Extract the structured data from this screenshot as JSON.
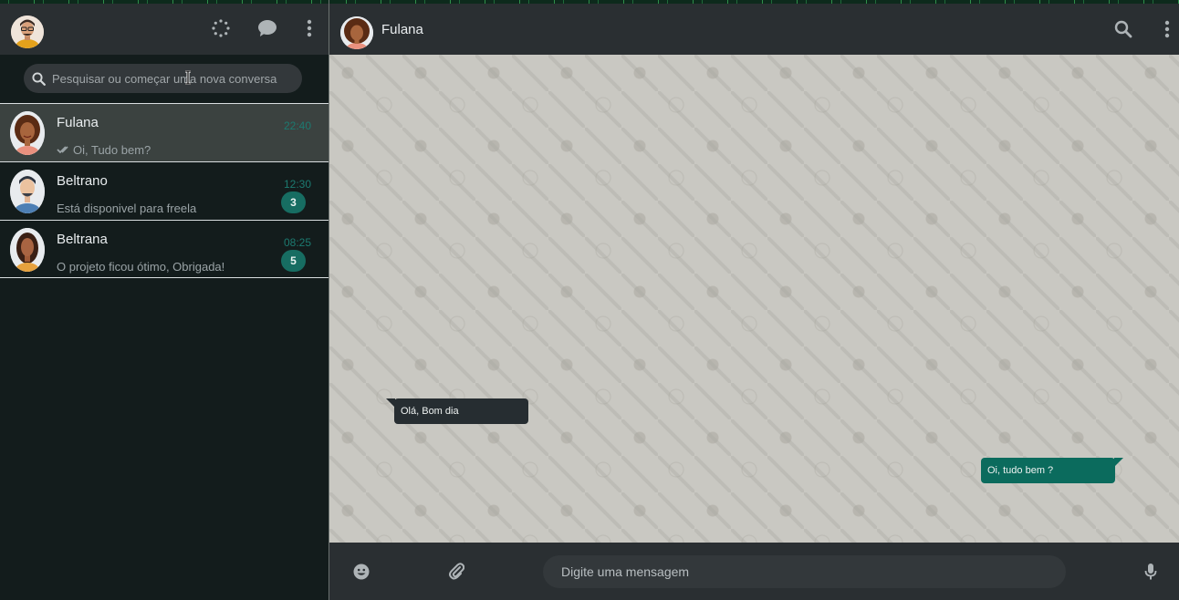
{
  "sidebar": {
    "search": {
      "placeholder": "Pesquisar ou começar uma nova conversa"
    },
    "chats": [
      {
        "name": "Fulana",
        "time": "22:40",
        "preview": "Oi, Tudo bem?",
        "read_receipt": true,
        "unread": null,
        "active": true
      },
      {
        "name": "Beltrano",
        "time": "12:30",
        "preview": "Está disponivel para freela",
        "read_receipt": false,
        "unread": "3",
        "active": false
      },
      {
        "name": "Beltrana",
        "time": "08:25",
        "preview": "O projeto ficou ótimo, Obrigada!",
        "read_receipt": false,
        "unread": "5",
        "active": false
      }
    ]
  },
  "conversation": {
    "contact_name": "Fulana",
    "messages": [
      {
        "direction": "incoming",
        "text": "Olá, Bom dia"
      },
      {
        "direction": "outgoing",
        "text": "Oi, tudo bem ?"
      }
    ],
    "composer": {
      "placeholder": "Digite uma mensagem"
    }
  },
  "icons": {
    "status": "status-icon",
    "new_chat": "chat-icon",
    "menu": "menu-dots-icon",
    "search": "search-icon",
    "emoji": "emoji-icon",
    "attach": "paperclip-icon",
    "mic": "mic-icon",
    "read": "double-check-icon"
  },
  "colors": {
    "accent": "#0b6b5d",
    "header": "#2a2f32",
    "sidebar_bg": "#131c1c",
    "chat_bg": "#c9c8c2",
    "incoming_bubble": "#262d31",
    "time_teal": "#1c7a70"
  }
}
